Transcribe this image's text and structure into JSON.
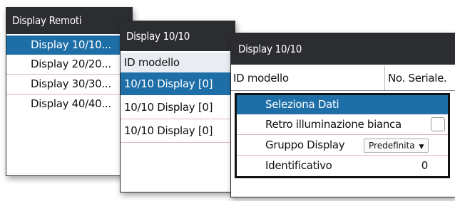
{
  "window1": {
    "title": "Display Remoti",
    "items": [
      "Display 10/10...",
      "Display 20/20...",
      "Display 30/30...",
      "Display 40/40..."
    ]
  },
  "window2": {
    "title": "Display 10/10",
    "header": "ID modello",
    "items": [
      "10/10 Display [0]",
      "10/10 Display [0]",
      "10/10 Display [0]"
    ]
  },
  "window3": {
    "title": "Display 10/10",
    "col_model": "ID modello",
    "col_serial": "No. Seriale."
  },
  "dialog": {
    "title": "Seleziona Dati",
    "backlight_label": "Retro illuminazione bianca",
    "backlight_checked": false,
    "group_label": "Gruppo Display",
    "group_value": "Predefinita",
    "id_label": "Identificativo",
    "id_value": "0"
  },
  "colors": {
    "titlebar": "#2b2d31",
    "selection": "#1e6fa8",
    "dialog_header": "#1e6fa8"
  }
}
